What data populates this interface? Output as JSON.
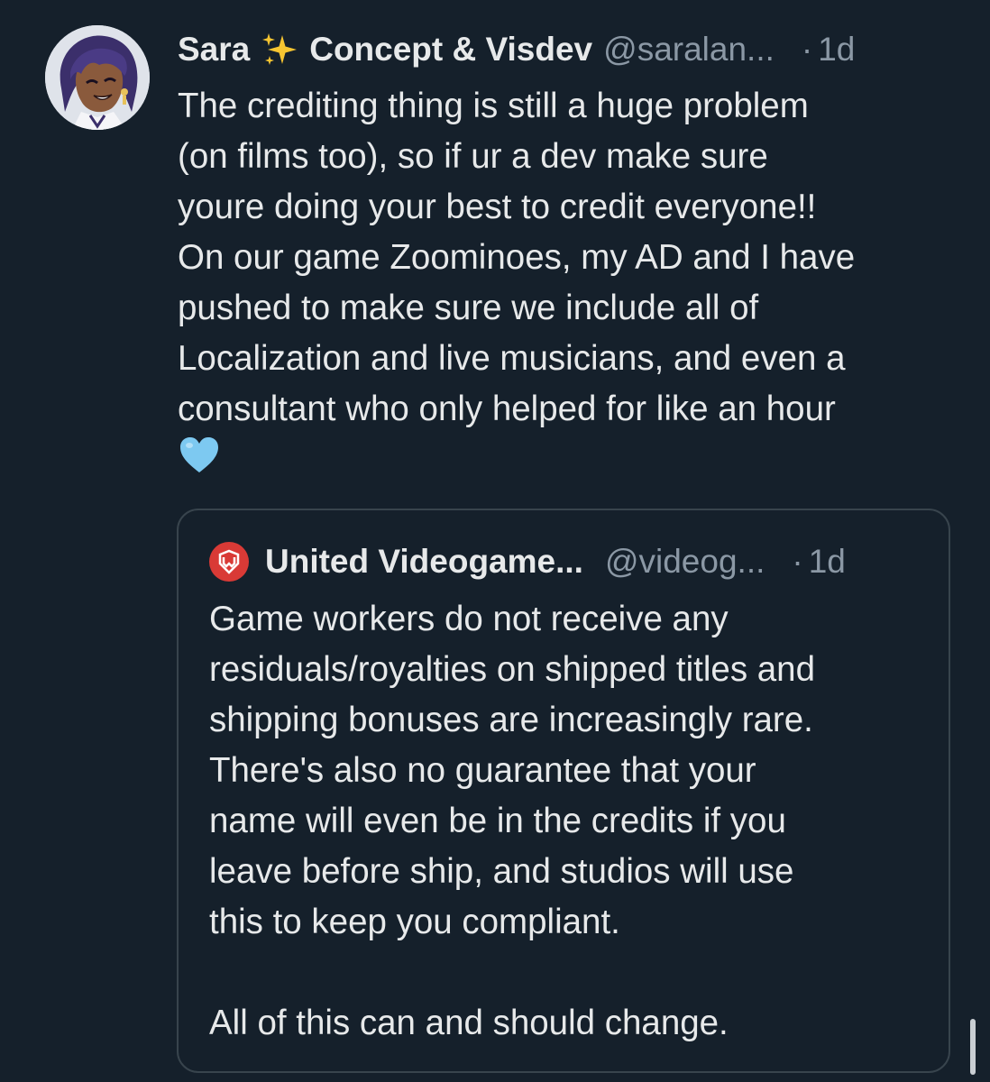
{
  "post": {
    "display_name": "Sara",
    "name_emoji": "sparkles",
    "display_name_suffix": "Concept & Visdev",
    "handle": "@saralan...",
    "separator": "·",
    "time": "1d",
    "text": "The crediting thing is still a huge problem\n(on films too), so if ur a dev make sure\nyoure doing your best to credit everyone!!\nOn our game Zoominoes, my AD and I have\npushed to make sure we include all of\nLocalization and live musicians, and even a\nconsultant who only helped for like an hour",
    "trailing_emoji": "light-blue-heart",
    "avatar_icon": "anime-character-avatar-icon"
  },
  "quoted_post": {
    "display_name": "United Videogame...",
    "handle": "@videog...",
    "separator": "·",
    "time": "1d",
    "avatar_icon": "union-logo-icon",
    "text": "Game workers do not receive any\nresiduals/royalties on shipped titles and\nshipping bonuses are increasingly rare.\nThere's also no guarantee that your\nname will even be in the credits if you\nleave before ship, and studios will use\nthis to keep you compliant.\n\nAll of this can and should change."
  },
  "colors": {
    "background": "#15202b",
    "text_primary": "#e7e9ea",
    "text_secondary": "#8b98a5",
    "border": "#38444d",
    "union_red": "#d93a36",
    "heart_blue": "#7dc9f1",
    "sparkle_yellow": "#f7c531"
  }
}
